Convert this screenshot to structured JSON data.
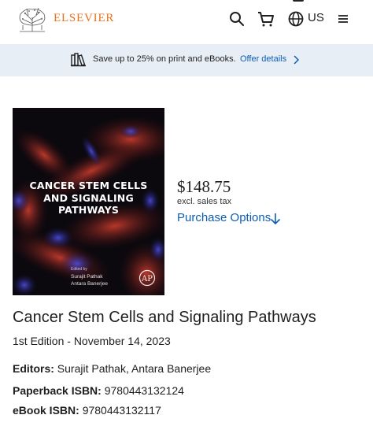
{
  "header": {
    "brand": "ELSEVIER",
    "region": "US",
    "icons": [
      "elsevier-tree-logo",
      "search-icon",
      "cart-icon",
      "globe-icon",
      "menu-icon"
    ]
  },
  "banner": {
    "icon": "books-icon",
    "text": "Save up to 25% on print and eBooks.",
    "link": "Offer details",
    "link_icon": "chevron-right-icon"
  },
  "cover": {
    "title_lines": [
      "CANCER STEM CELLS",
      "AND SIGNALING",
      "PATHWAYS"
    ],
    "edited_by": "Edited by",
    "editors": [
      "Surajit Pathak",
      "Antara Banerjee"
    ],
    "publisher_mark": "AP"
  },
  "pricing": {
    "price": "$148.75",
    "tax_note": "excl. sales tax",
    "purchase_options": "Purchase Options"
  },
  "book": {
    "title": "Cancer Stem Cells and Signaling Pathways",
    "edition_line": "1st Edition - November 14, 2023",
    "editors_label": "Editors:",
    "editors_value": "Surajit Pathak, Antara Banerjee",
    "paperback_label": "Paperback ISBN:",
    "paperback_value": "9780443132124",
    "ebook_label": "eBook ISBN:",
    "ebook_value": "9780443132117"
  },
  "colors": {
    "brand_orange": "#e9711c",
    "link_blue": "#0c5db3",
    "banner_bg": "#e8eef6"
  }
}
